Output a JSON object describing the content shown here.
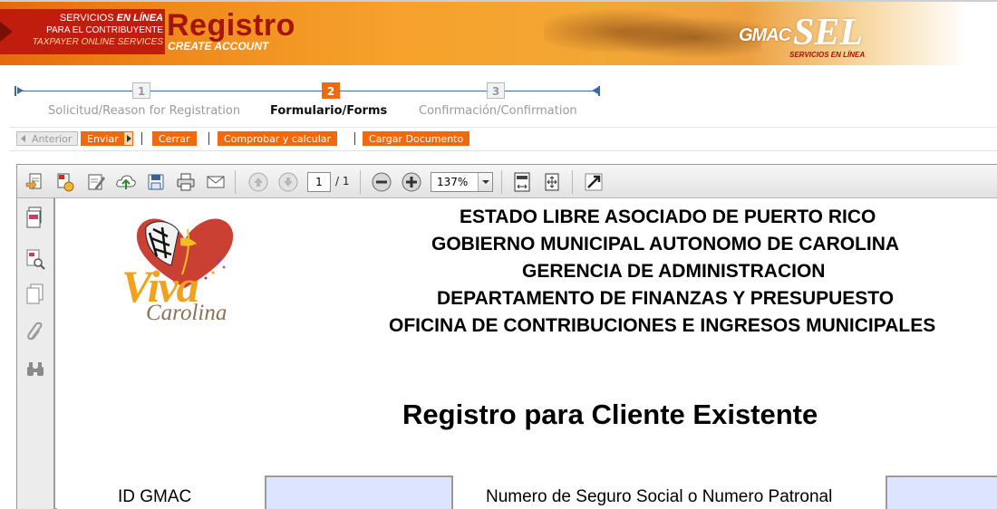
{
  "banner": {
    "brand_line1_prefix": "SERVICIOS",
    "brand_line1_bold": "EN LÍNEA",
    "brand_line2": "PARA EL CONTRIBUYENTE",
    "brand_line3": "TAXPAYER ONLINE SERVICES",
    "title": "Registro",
    "subtitle": "CREATE ACCOUNT",
    "partner_logo_left": "GMAC",
    "partner_logo_right": "SEL",
    "partner_logo_sub": "SERVICIOS EN LÍNEA"
  },
  "steps": [
    {
      "number": "1",
      "label": "Solicitud/Reason for Registration",
      "state": "inactive"
    },
    {
      "number": "2",
      "label": "Formulario/Forms",
      "state": "active"
    },
    {
      "number": "3",
      "label": "Confirmación/Confirmation",
      "state": "inactive"
    }
  ],
  "actions": {
    "previous": "Anterior",
    "send": "Enviar",
    "close": "Cerrar",
    "verify": "Comprobar y calcular",
    "upload": "Cargar Documento"
  },
  "pdf_toolbar": {
    "page_current": "1",
    "page_total": "/ 1",
    "zoom": "137%",
    "icons": [
      "create-pdf-icon",
      "print-pdf-icon",
      "edit-icon",
      "upload-icon",
      "save-icon",
      "print-icon",
      "email-icon",
      "page-up-icon",
      "page-down-icon",
      "zoom-out-icon",
      "zoom-in-icon",
      "fit-page-icon",
      "fit-width-icon",
      "expand-icon"
    ]
  },
  "side_panel_icons": [
    "pages-icon",
    "search-pages-icon",
    "copy-icon",
    "attachment-icon",
    "binoculars-icon"
  ],
  "document": {
    "logo_word": "Viva",
    "logo_sub": "Carolina",
    "heading_lines": [
      "ESTADO LIBRE ASOCIADO DE PUERTO RICO",
      "GOBIERNO MUNICIPAL AUTONOMO DE CAROLINA",
      "GERENCIA DE ADMINISTRACION",
      "DEPARTAMENTO DE FINANZAS Y PRESUPUESTO",
      "OFICINA DE CONTRIBUCIONES E INGRESOS MUNICIPALES"
    ],
    "title": "Registro para Cliente Existente",
    "field_id_label": "ID GMAC",
    "field_ssn_label": "Numero de Seguro Social o Numero Patronal",
    "field_id_value": "",
    "field_ssn_value": ""
  },
  "colors": {
    "accent_orange": "#ef6a0e",
    "brand_red": "#c01d0e",
    "field_fill": "#dde4ff",
    "step_line": "#3a6aa0"
  }
}
